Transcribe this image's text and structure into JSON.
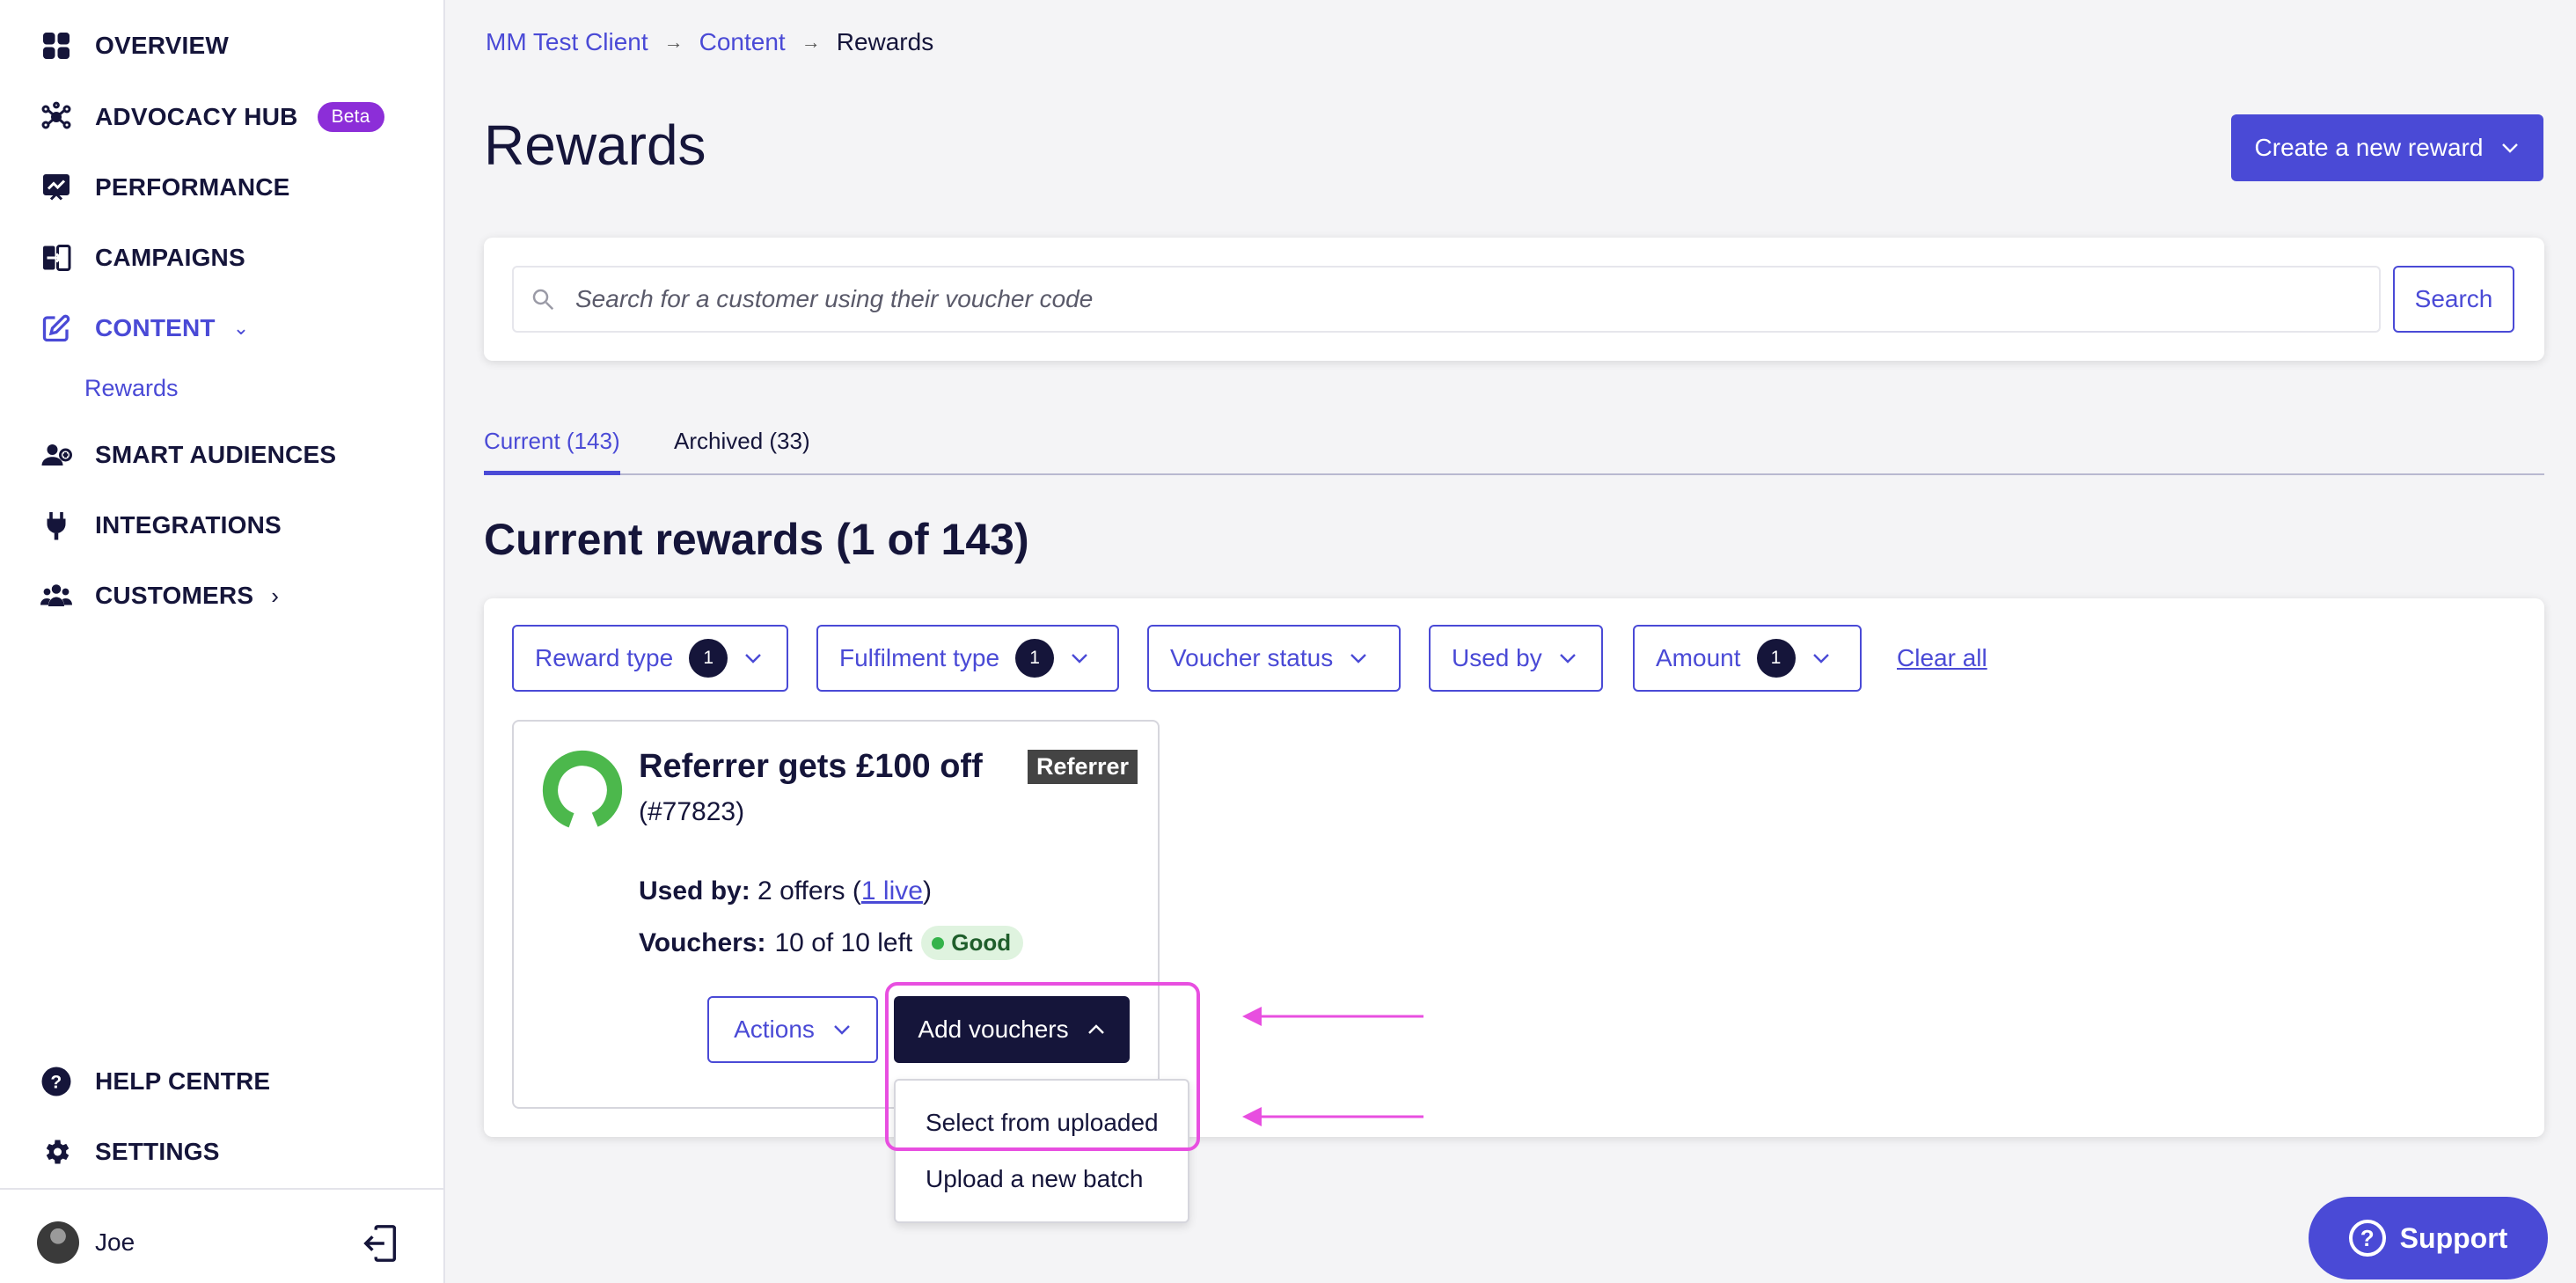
{
  "sidebar": {
    "items": [
      {
        "label": "OVERVIEW",
        "icon": "grid-icon"
      },
      {
        "label": "ADVOCACY HUB",
        "icon": "network-icon",
        "badge": "Beta"
      },
      {
        "label": "PERFORMANCE",
        "icon": "chart-board-icon"
      },
      {
        "label": "CAMPAIGNS",
        "icon": "campaign-icon"
      },
      {
        "label": "CONTENT",
        "icon": "edit-icon",
        "expanded": true
      },
      {
        "label": "SMART AUDIENCES",
        "icon": "audience-icon"
      },
      {
        "label": "INTEGRATIONS",
        "icon": "plug-icon"
      },
      {
        "label": "CUSTOMERS",
        "icon": "people-icon"
      },
      {
        "label": "HELP CENTRE",
        "icon": "help-icon"
      },
      {
        "label": "SETTINGS",
        "icon": "gear-icon"
      }
    ],
    "content_sub_item": "Rewards",
    "user_name": "Joe"
  },
  "breadcrumb": {
    "items": [
      "MM Test Client",
      "Content"
    ],
    "current": "Rewards"
  },
  "page": {
    "title": "Rewards",
    "create_button": "Create a new reward"
  },
  "search": {
    "placeholder": "Search for a customer using their voucher code",
    "button": "Search"
  },
  "tabs": [
    {
      "label": "Current (143)",
      "active": true
    },
    {
      "label": "Archived (33)",
      "active": false
    }
  ],
  "section_title": "Current rewards (1 of 143)",
  "filters": [
    {
      "label": "Reward type",
      "count": "1"
    },
    {
      "label": "Fulfilment type",
      "count": "1"
    },
    {
      "label": "Voucher status",
      "count": null
    },
    {
      "label": "Used by",
      "count": null
    },
    {
      "label": "Amount",
      "count": "1"
    }
  ],
  "clear_all": "Clear all",
  "reward": {
    "title": "Referrer gets £100 off",
    "id": "(#77823)",
    "tag": "Referrer",
    "used_by_label": "Used by:",
    "used_by_value": "2 offers (",
    "used_by_link": "1 live",
    "used_by_close": ")",
    "vouchers_label": "Vouchers:",
    "vouchers_value": "10 of 10 left",
    "status": "Good",
    "actions_button": "Actions",
    "add_button": "Add vouchers"
  },
  "dropdown": {
    "items": [
      "Select from uploaded",
      "Upload a new batch"
    ]
  },
  "support": "Support",
  "colors": {
    "accent": "#4a4ad6",
    "navy": "#15153a",
    "highlight": "#e84fe0",
    "good": "#34b34a"
  }
}
